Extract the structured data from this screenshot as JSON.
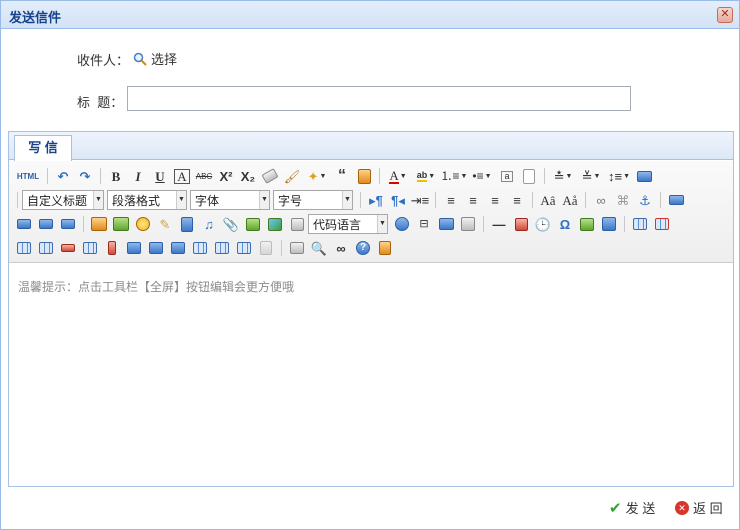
{
  "window": {
    "title": "发送信件",
    "close_glyph": "✕"
  },
  "form": {
    "recipient_label": "收件人：",
    "picker_label": "选择",
    "picker_icon": "search-icon",
    "subject_label": "标  题：",
    "subject_value": ""
  },
  "editor": {
    "tab_label": "写 信",
    "toolbar": {
      "html_label": "HTML",
      "combos": {
        "heading": "自定义标题",
        "paragraph": "段落格式",
        "font": "字体",
        "size": "字号",
        "code_lang": "代码语言"
      }
    },
    "hint": "温馨提示：点击工具栏【全屏】按钮编辑会更方便哦"
  },
  "footer": {
    "send_label": "发 送",
    "back_label": "返 回"
  },
  "colors": {
    "title": "#15428b",
    "border": "#99bbe8",
    "hint": "#8c8c8c"
  }
}
